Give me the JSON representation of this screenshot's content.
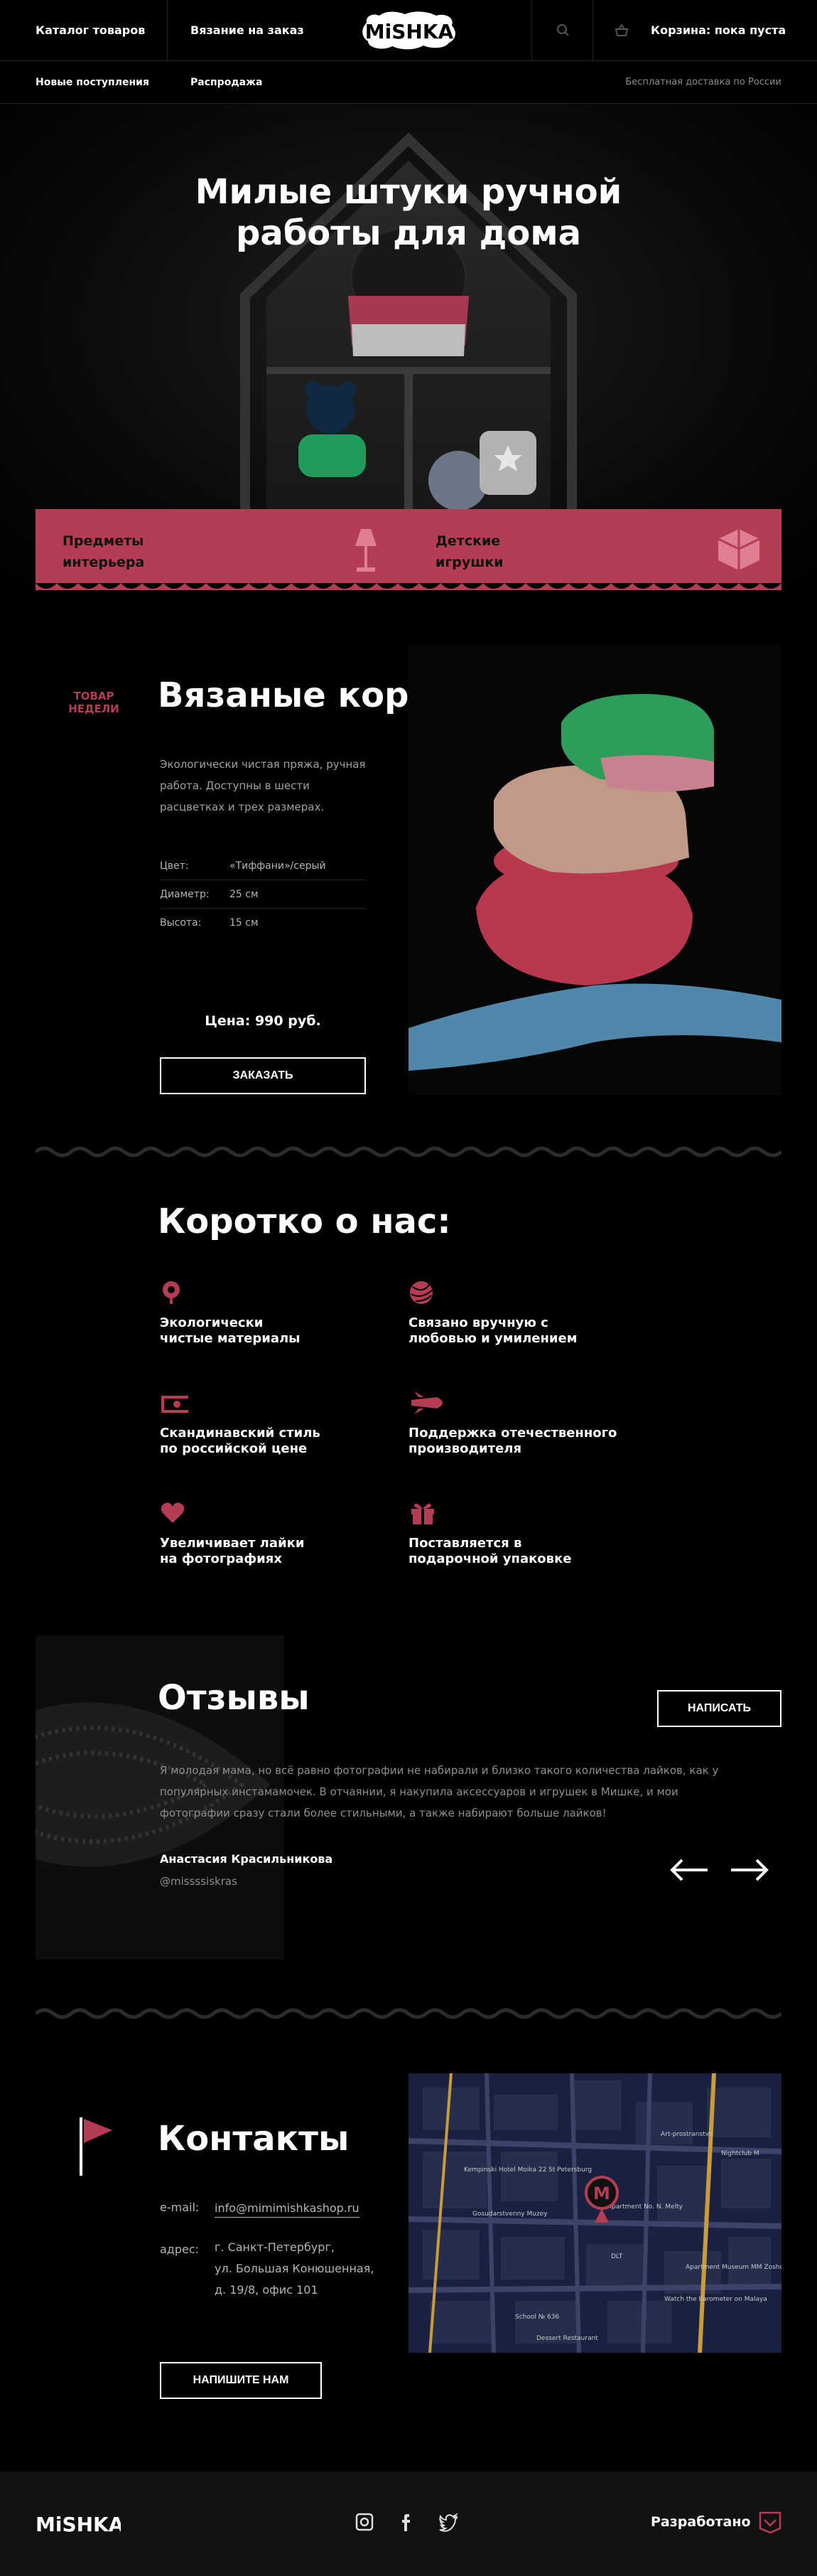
{
  "header": {
    "catalog": "Каталог товаров",
    "custom": "Вязание на заказ",
    "logo": "MiSHKA",
    "cart": "Корзина: пока пуста"
  },
  "subnav": {
    "new": "Новые поступления",
    "sale": "Распродажа",
    "promo": "Бесплатная доставка по России"
  },
  "hero": {
    "title": "Милые штуки ручной работы для дома",
    "cards": [
      "Предметы\nинтерьера",
      "Детские\nигрушки"
    ]
  },
  "product": {
    "badge": "ТОВАР НЕДЕЛИ",
    "title": "Вязаные корзинки",
    "description": "Экологически чистая пряжа, ручная работа. Доступны в шести расцветках и трех размерах.",
    "specs": [
      {
        "key": "Цвет:",
        "value": "«Тиффани»/серый"
      },
      {
        "key": "Диаметр:",
        "value": "25 см"
      },
      {
        "key": "Высота:",
        "value": "15 см"
      }
    ],
    "price": "Цена: 990 руб.",
    "order_label": "ЗАКАЗАТЬ"
  },
  "about": {
    "title": "Коротко о нас:",
    "features": [
      {
        "icon": "eco-icon",
        "text": "Экологически\nчистые материалы"
      },
      {
        "icon": "yarn-ball-icon",
        "text": "Связано вручную с\nлюбовью и умилением"
      },
      {
        "icon": "money-icon",
        "text": "Скандинавский стиль\nпо российской цене"
      },
      {
        "icon": "rocket-icon",
        "text": "Поддержка отечественного\nпроизводителя"
      },
      {
        "icon": "heart-icon",
        "text": "Увеличивает лайки\nна фотографиях"
      },
      {
        "icon": "gift-icon",
        "text": "Поставляется в\nподарочной упаковке"
      }
    ]
  },
  "reviews": {
    "title": "Отзывы",
    "write_label": "НАПИСАТЬ",
    "text": "Я молодая мама, но всё равно фотографии не набирали и близко такого количества лайков, как у популярных инстамамочек. В отчаянии, я накупила аксессуаров и игрушек в Мишке, и мои фотографии сразу стали более стильными, а также набирают больше лайков!",
    "author": "Анастасия Красильникова",
    "nick": "@missssiskras"
  },
  "contacts": {
    "title": "Контакты",
    "email_label": "e-mail:",
    "email": "info@mimimishkashop.ru",
    "address_label": "адрес:",
    "address_lines": [
      "г. Санкт-Петербург,",
      "ул. Большая Конюшенная,",
      "д. 19/8, офис 101"
    ],
    "write_us_label": "НАПИШИТЕ НАМ",
    "map_labels": [
      "Kempinski Hotel Moika 22 St Petersburg",
      "Gosudarstvenny Muzey",
      "Art-prostranstvo",
      "Nightclub M",
      "Apartment Museum MM Zoshchenko",
      "Watch the barometer on Malaya",
      "School № 636",
      "Dessert Restaurant",
      "Apartment No. N. Melty",
      "DLT"
    ],
    "map_marker": "M"
  },
  "footer": {
    "logo": "MiSHKA",
    "developed": "Разработано"
  },
  "colors": {
    "accent": "#b43c53",
    "background": "#000000",
    "footer": "#121212"
  }
}
